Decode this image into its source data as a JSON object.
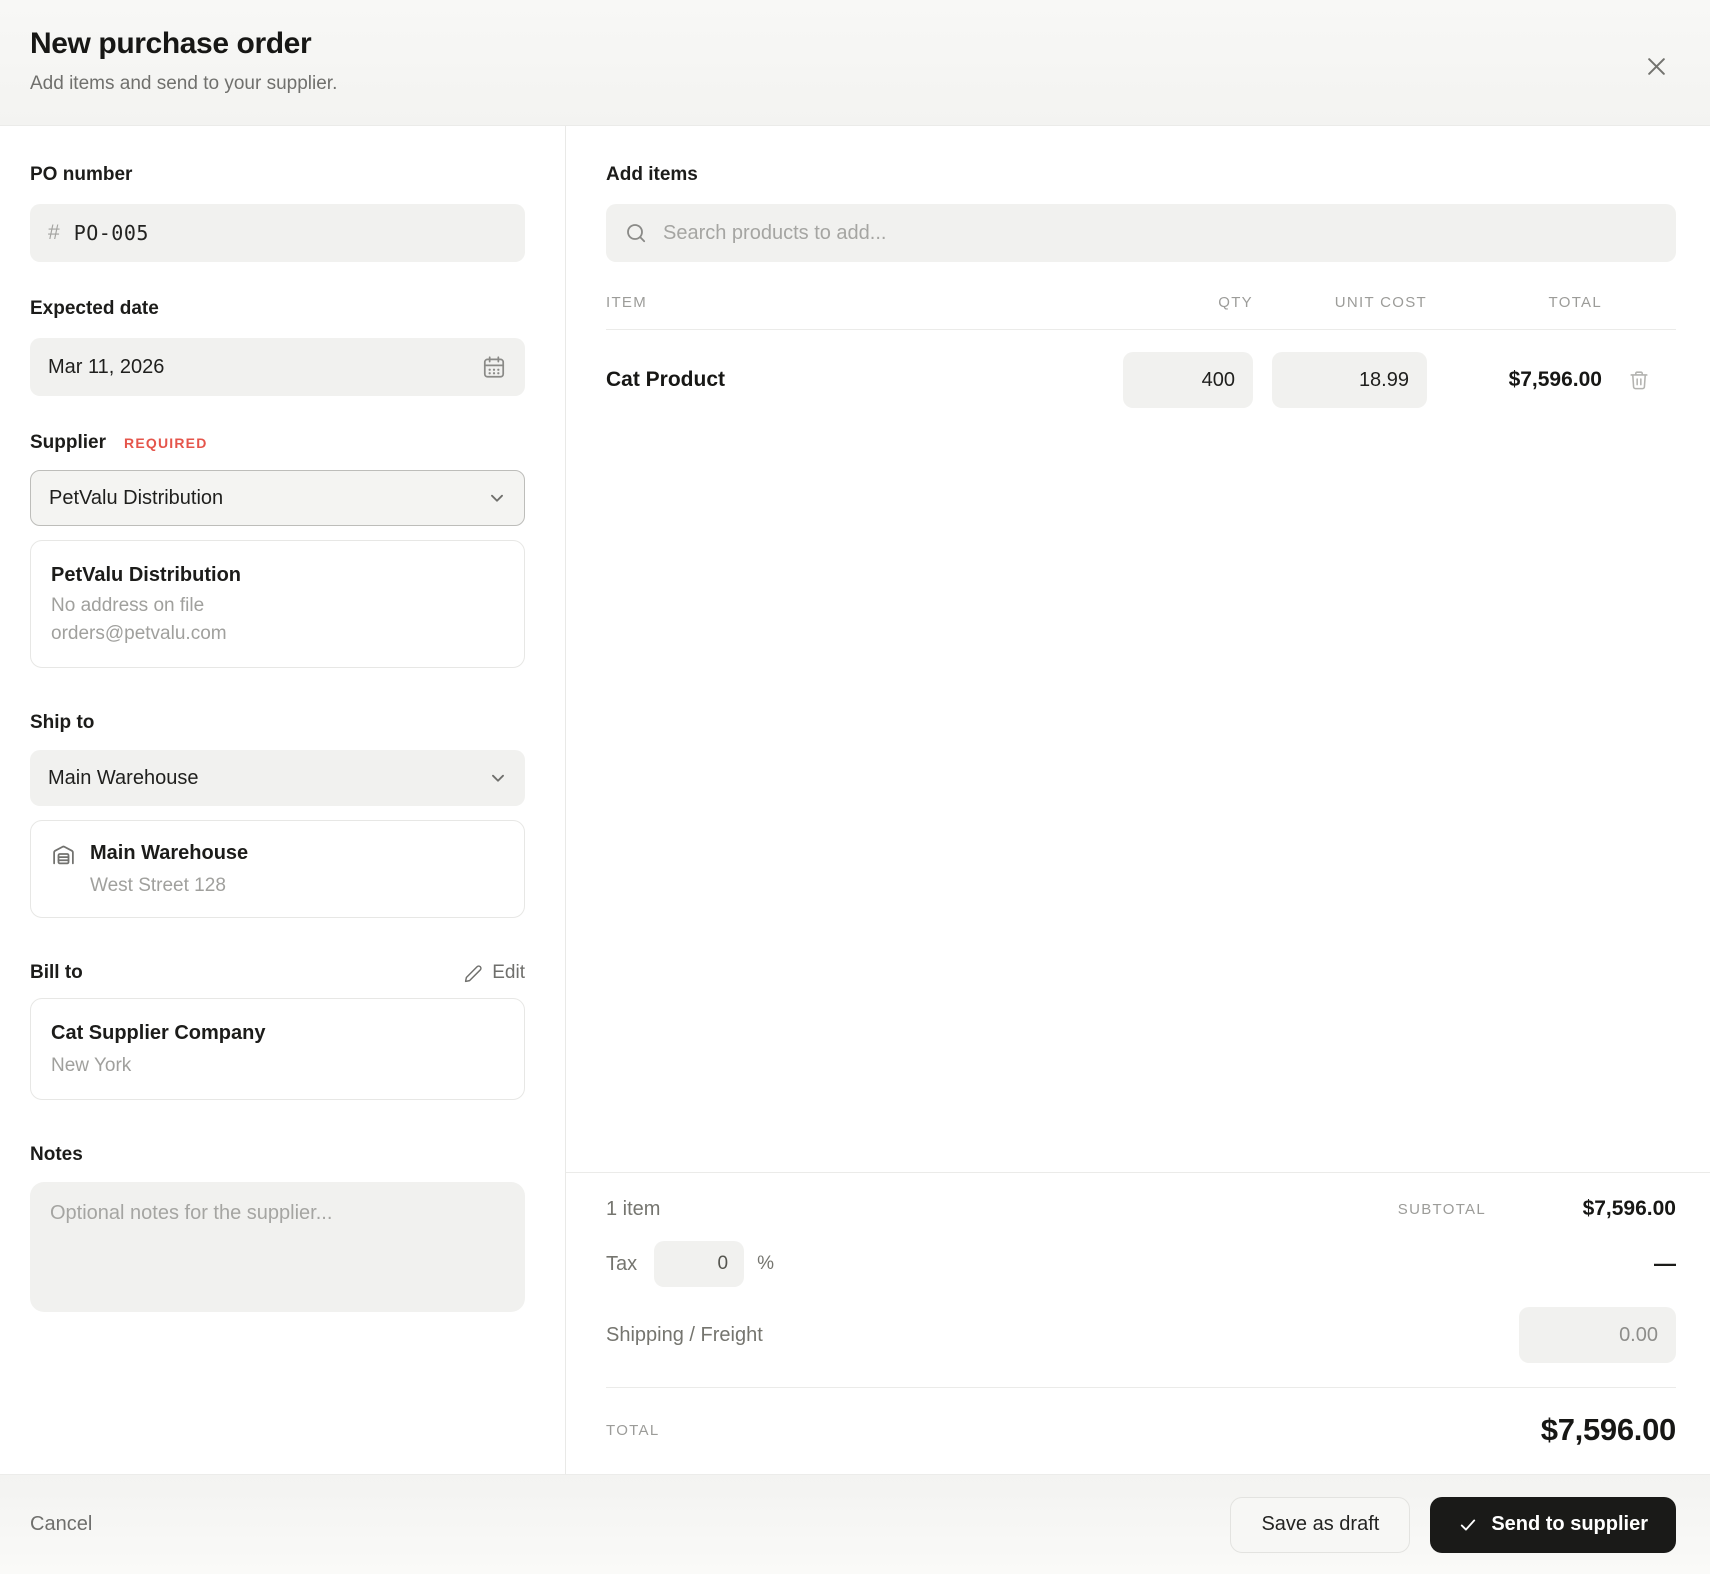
{
  "header": {
    "title": "New purchase order",
    "subtitle": "Add items and send to your supplier."
  },
  "po": {
    "label": "PO number",
    "prefix": "#",
    "value": "PO-005"
  },
  "date": {
    "label": "Expected date",
    "value": "Mar 11, 2026"
  },
  "supplier": {
    "label": "Supplier",
    "required": "REQUIRED",
    "selected": "PetValu Distribution",
    "name": "PetValu Distribution",
    "address": "No address on file",
    "email": "orders@petvalu.com"
  },
  "ship": {
    "label": "Ship to",
    "selected": "Main Warehouse",
    "name": "Main Warehouse",
    "address": "West Street 128"
  },
  "bill": {
    "label": "Bill to",
    "edit": "Edit",
    "name": "Cat Supplier Company",
    "address": "New York"
  },
  "notes": {
    "label": "Notes",
    "placeholder": "Optional notes for the supplier..."
  },
  "items": {
    "label": "Add items",
    "search_placeholder": "Search products to add...",
    "col_item": "ITEM",
    "col_qty": "QTY",
    "col_cost": "UNIT COST",
    "col_total": "TOTAL",
    "rows": [
      {
        "name": "Cat Product",
        "qty": "400",
        "unit_cost": "18.99",
        "total": "$7,596.00"
      }
    ]
  },
  "summary": {
    "count": "1 item",
    "subtotal_label": "SUBTOTAL",
    "subtotal": "$7,596.00",
    "tax_label": "Tax",
    "tax_value": "0",
    "tax_unit": "%",
    "tax_amount": "—",
    "shipping_label": "Shipping / Freight",
    "shipping_value": "0.00",
    "total_label": "TOTAL",
    "total": "$7,596.00"
  },
  "footer": {
    "cancel": "Cancel",
    "save_draft": "Save as draft",
    "send": "Send to supplier"
  },
  "colors": {
    "accent_dark": "#1a1a18",
    "required_red": "#e5554b",
    "input_gray": "#f1f1ef"
  }
}
